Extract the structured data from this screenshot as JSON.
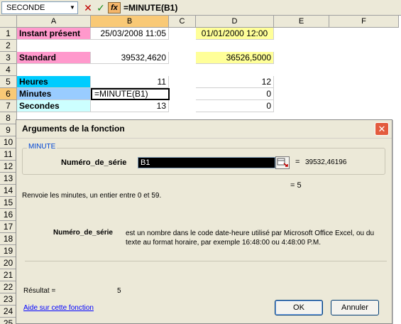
{
  "formula_bar": {
    "name_box": "SECONDE",
    "name_box_arrow": "▼",
    "cancel_glyph": "✕",
    "enter_glyph": "✓",
    "fx_glyph": "fx",
    "formula": "=MINUTE(B1)"
  },
  "columns": [
    "A",
    "B",
    "C",
    "D",
    "E",
    "F"
  ],
  "active_column": "B",
  "active_row": "6",
  "rows": [
    "1",
    "2",
    "3",
    "4",
    "5",
    "6",
    "7",
    "8",
    "9",
    "10",
    "11",
    "12",
    "13",
    "14",
    "15",
    "16",
    "17",
    "18",
    "19",
    "20",
    "21",
    "22",
    "23",
    "24",
    "25"
  ],
  "cells": {
    "A1": "Instant présent",
    "B1": "25/03/2008 11:05",
    "D1": "01/01/2000 12:00",
    "A3": "Standard",
    "B3": "39532,4620",
    "D3": "36526,5000",
    "A5": "Heures",
    "B5": "11",
    "D5": "12",
    "A6": "Minutes",
    "B6": "=MINUTE(B1)",
    "D6": "0",
    "A7": "Secondes",
    "B7": "13",
    "D7": "0"
  },
  "colors": {
    "pink": "#ff99cc",
    "yellow": "#ffff99",
    "cyan": "#00ccff",
    "light_blue": "#99ccff",
    "light_cyan": "#ccffff",
    "selected_header": "#f9c976"
  },
  "dialog": {
    "title": "Arguments de la fonction",
    "close_glyph": "✕",
    "function_name": "MINUTE",
    "arg_label": "Numéro_de_série",
    "arg_value": "B1",
    "arg_eq": "=",
    "arg_evaluated": "39532,46196",
    "result_eq": "= 5",
    "description": "Renvoie les minutes, un entier entre 0 et 59.",
    "arg_name_detail": "Numéro_de_série",
    "arg_description": "est un nombre dans le code date-heure utilisé par Microsoft Office Excel, ou du texte au format horaire, par exemple 16:48:00 ou 4:48:00 P.M.",
    "result_label": "Résultat =",
    "result_value": "5",
    "help_link": "Aide sur cette fonction",
    "ok_label": "OK",
    "cancel_label": "Annuler"
  }
}
